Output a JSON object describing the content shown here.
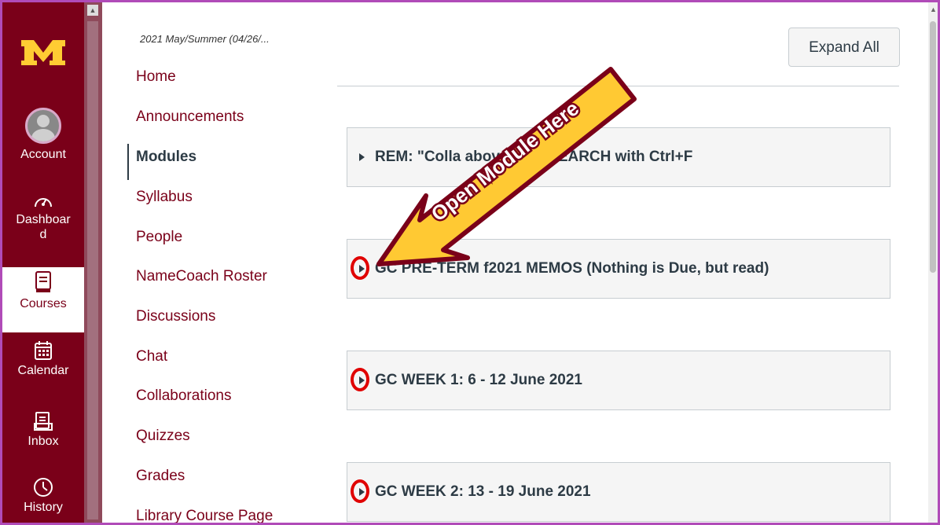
{
  "global_nav": {
    "items": [
      {
        "label": "Account",
        "icon": "account-avatar-icon"
      },
      {
        "label": "Dashboard",
        "icon": "dashboard-icon"
      },
      {
        "label": "Courses",
        "icon": "courses-icon",
        "active": true
      },
      {
        "label": "Calendar",
        "icon": "calendar-icon"
      },
      {
        "label": "Inbox",
        "icon": "inbox-icon"
      },
      {
        "label": "History",
        "icon": "history-icon"
      }
    ],
    "dashboard_line1": "Dashboar",
    "dashboard_line2": "d"
  },
  "course": {
    "term": "2021 May/Summer (04/26/...",
    "nav": [
      "Home",
      "Announcements",
      "Modules",
      "Syllabus",
      "People",
      "NameCoach Roster",
      "Discussions",
      "Chat",
      "Collaborations",
      "Quizzes",
      "Grades",
      "Library Course Page"
    ],
    "active": "Modules"
  },
  "main": {
    "expand_all": "Expand All",
    "modules": [
      "REM: \"Colla                   above) and SEARCH with Ctrl+F",
      "GC PRE-TERM f2021 MEMOS (Nothing is Due, but read)",
      "GC WEEK 1: 6 - 12 June 2021",
      "GC WEEK 2: 13 - 19 June 2021"
    ]
  },
  "annotation": {
    "text": "Open Module Here"
  },
  "colors": {
    "brand": "#7a0019",
    "gold": "#ffcc33",
    "highlight_circle": "#e00000",
    "frame_border": "#b04bb8"
  }
}
